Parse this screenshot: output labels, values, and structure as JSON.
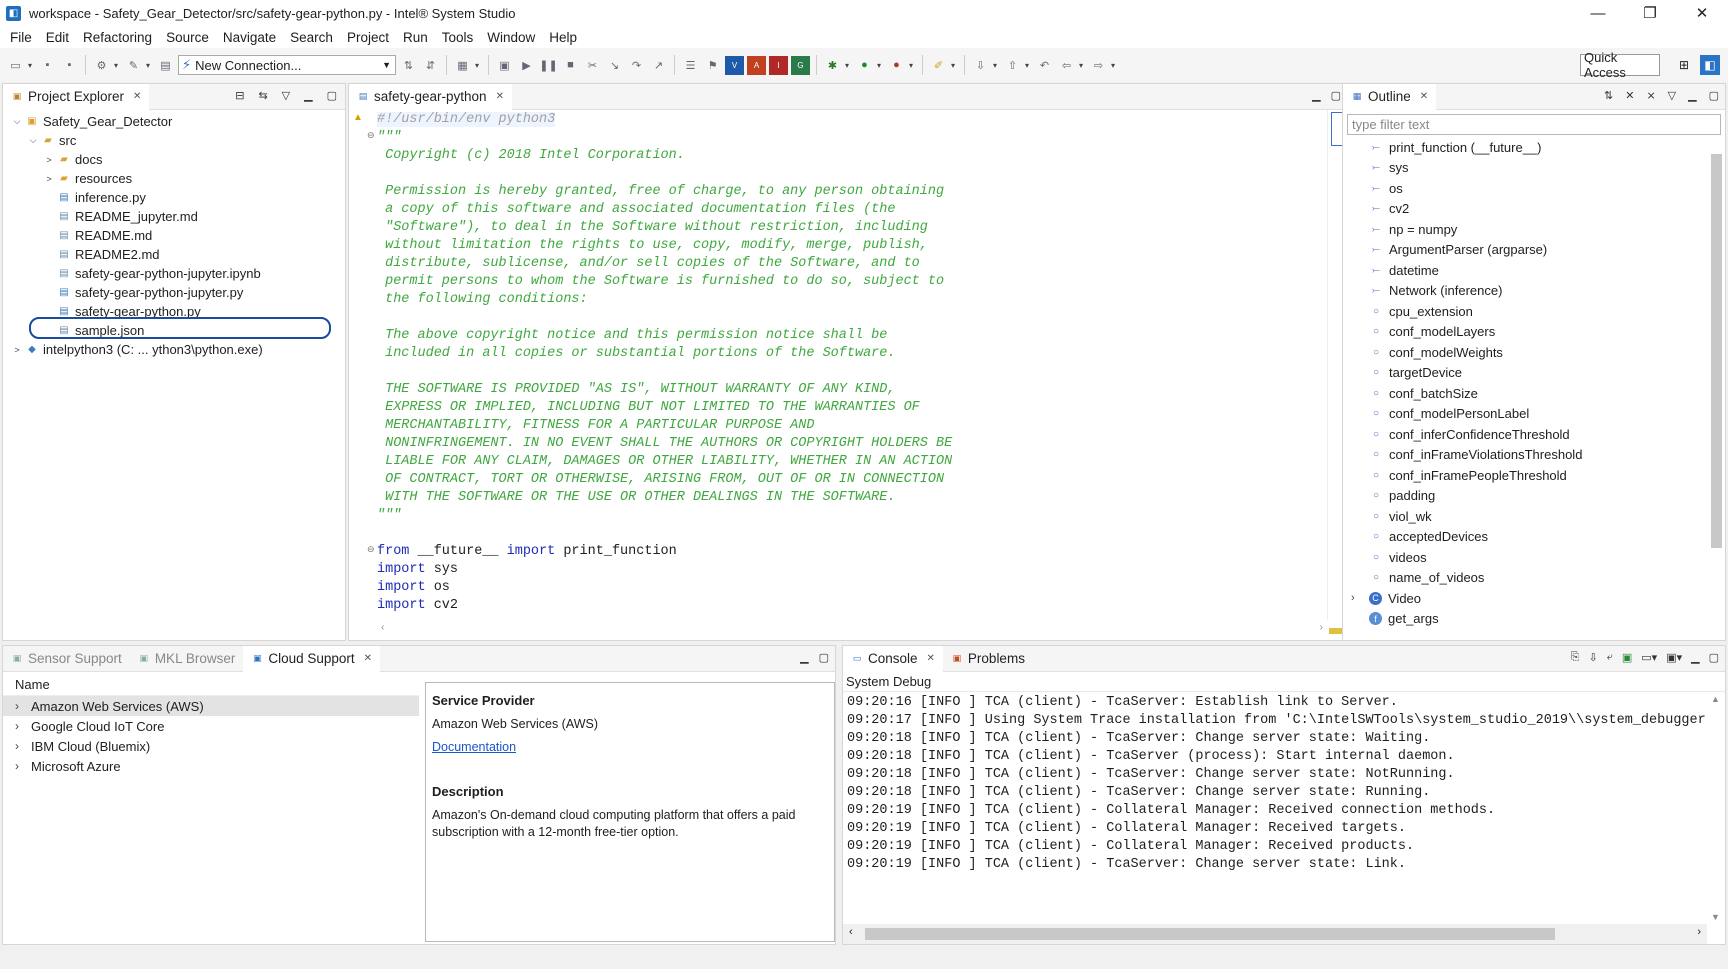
{
  "window": {
    "title": "workspace - Safety_Gear_Detector/src/safety-gear-python.py - Intel® System Studio",
    "minimize": "—",
    "restore": "❐",
    "close": "✕"
  },
  "menu": [
    "File",
    "Edit",
    "Refactoring",
    "Source",
    "Navigate",
    "Search",
    "Project",
    "Run",
    "Tools",
    "Window",
    "Help"
  ],
  "toolbar": {
    "connection": "New Connection...",
    "quick_access": "Quick Access"
  },
  "project_explorer": {
    "tab": "Project Explorer",
    "items": [
      {
        "label": "Safety_Gear_Detector",
        "depth": 0,
        "twisty": "⌵",
        "icon": "project-icon"
      },
      {
        "label": "src",
        "depth": 1,
        "twisty": "⌵",
        "icon": "folder-icon"
      },
      {
        "label": "docs",
        "depth": 2,
        "twisty": ">",
        "icon": "folder-icon"
      },
      {
        "label": "resources",
        "depth": 2,
        "twisty": ">",
        "icon": "folder-icon"
      },
      {
        "label": "inference.py",
        "depth": 2,
        "twisty": "",
        "icon": "python-file-icon"
      },
      {
        "label": "README_jupyter.md",
        "depth": 2,
        "twisty": "",
        "icon": "file-icon"
      },
      {
        "label": "README.md",
        "depth": 2,
        "twisty": "",
        "icon": "file-icon"
      },
      {
        "label": "README2.md",
        "depth": 2,
        "twisty": "",
        "icon": "file-icon"
      },
      {
        "label": "safety-gear-python-jupyter.ipynb",
        "depth": 2,
        "twisty": "",
        "icon": "file-icon"
      },
      {
        "label": "safety-gear-python-jupyter.py",
        "depth": 2,
        "twisty": "",
        "icon": "python-file-icon"
      },
      {
        "label": "safety-gear-python.py",
        "depth": 2,
        "twisty": "",
        "icon": "python-file-icon"
      },
      {
        "label": "sample.json",
        "depth": 2,
        "twisty": "",
        "icon": "file-icon"
      },
      {
        "label": "intelpython3   (C: ... ython3\\python.exe)",
        "depth": 0,
        "twisty": ">",
        "icon": "python-interpreter-icon"
      }
    ]
  },
  "editor": {
    "tab": "safety-gear-python",
    "lines": [
      {
        "t": "#!/usr/bin/env python3",
        "c": "shebang"
      },
      {
        "t": "\"\"\"",
        "c": "cmt"
      },
      {
        "t": " Copyright (c) 2018 Intel Corporation.",
        "c": "cmt"
      },
      {
        "t": "",
        "c": "cmt"
      },
      {
        "t": " Permission is hereby granted, free of charge, to any person obtaining",
        "c": "cmt"
      },
      {
        "t": " a copy of this software and associated documentation files (the",
        "c": "cmt"
      },
      {
        "t": " \"Software\"), to deal in the Software without restriction, including",
        "c": "cmt"
      },
      {
        "t": " without limitation the rights to use, copy, modify, merge, publish,",
        "c": "cmt"
      },
      {
        "t": " distribute, sublicense, and/or sell copies of the Software, and to",
        "c": "cmt"
      },
      {
        "t": " permit persons to whom the Software is furnished to do so, subject to",
        "c": "cmt"
      },
      {
        "t": " the following conditions:",
        "c": "cmt"
      },
      {
        "t": "",
        "c": "cmt"
      },
      {
        "t": " The above copyright notice and this permission notice shall be",
        "c": "cmt"
      },
      {
        "t": " included in all copies or substantial portions of the Software.",
        "c": "cmt"
      },
      {
        "t": "",
        "c": "cmt"
      },
      {
        "t": " THE SOFTWARE IS PROVIDED \"AS IS\", WITHOUT WARRANTY OF ANY KIND,",
        "c": "cmt"
      },
      {
        "t": " EXPRESS OR IMPLIED, INCLUDING BUT NOT LIMITED TO THE WARRANTIES OF",
        "c": "cmt"
      },
      {
        "t": " MERCHANTABILITY, FITNESS FOR A PARTICULAR PURPOSE AND",
        "c": "cmt"
      },
      {
        "t": " NONINFRINGEMENT. IN NO EVENT SHALL THE AUTHORS OR COPYRIGHT HOLDERS BE",
        "c": "cmt"
      },
      {
        "t": " LIABLE FOR ANY CLAIM, DAMAGES OR OTHER LIABILITY, WHETHER IN AN ACTION",
        "c": "cmt"
      },
      {
        "t": " OF CONTRACT, TORT OR OTHERWISE, ARISING FROM, OUT OF OR IN CONNECTION",
        "c": "cmt"
      },
      {
        "t": " WITH THE SOFTWARE OR THE USE OR OTHER DEALINGS IN THE SOFTWARE.",
        "c": "cmt"
      },
      {
        "t": "\"\"\"",
        "c": "cmt"
      },
      {
        "t": "",
        "c": ""
      },
      {
        "t": "from __future__ import print_function",
        "c": "code"
      },
      {
        "t": "import sys",
        "c": "code"
      },
      {
        "t": "import os",
        "c": "code"
      },
      {
        "t": "import cv2",
        "c": "code"
      }
    ]
  },
  "outline": {
    "tab": "Outline",
    "filter_placeholder": "type filter text",
    "items": [
      {
        "label": "print_function (__future__)",
        "kind": "import"
      },
      {
        "label": "sys",
        "kind": "import"
      },
      {
        "label": "os",
        "kind": "import"
      },
      {
        "label": "cv2",
        "kind": "import"
      },
      {
        "label": "np = numpy",
        "kind": "import"
      },
      {
        "label": "ArgumentParser (argparse)",
        "kind": "import"
      },
      {
        "label": "datetime",
        "kind": "import"
      },
      {
        "label": "Network (inference)",
        "kind": "import"
      },
      {
        "label": "cpu_extension",
        "kind": "var"
      },
      {
        "label": "conf_modelLayers",
        "kind": "var"
      },
      {
        "label": "conf_modelWeights",
        "kind": "var"
      },
      {
        "label": "targetDevice",
        "kind": "var"
      },
      {
        "label": "conf_batchSize",
        "kind": "var"
      },
      {
        "label": "conf_modelPersonLabel",
        "kind": "var"
      },
      {
        "label": "conf_inferConfidenceThreshold",
        "kind": "var"
      },
      {
        "label": "conf_inFrameViolationsThreshold",
        "kind": "var"
      },
      {
        "label": "conf_inFramePeopleThreshold",
        "kind": "var"
      },
      {
        "label": "padding",
        "kind": "var"
      },
      {
        "label": "viol_wk",
        "kind": "var"
      },
      {
        "label": "acceptedDevices",
        "kind": "var"
      },
      {
        "label": "videos",
        "kind": "var"
      },
      {
        "label": "name_of_videos",
        "kind": "var"
      },
      {
        "label": "Video",
        "kind": "class"
      },
      {
        "label": "get_args",
        "kind": "function"
      }
    ]
  },
  "bottom_left": {
    "tabs": [
      "Sensor Support",
      "MKL Browser",
      "Cloud Support"
    ],
    "column_header": "Name",
    "providers": [
      "Amazon Web Services (AWS)",
      "Google Cloud IoT Core",
      "IBM Cloud (Bluemix)",
      "Microsoft Azure"
    ],
    "detail": {
      "provider_heading": "Service Provider",
      "provider_value": "Amazon Web Services (AWS)",
      "doc_link": "Documentation",
      "description_heading": "Description",
      "description": "Amazon's On-demand cloud computing platform that offers a paid subscription with a 12-month free-tier option."
    }
  },
  "console": {
    "tabs": [
      "Console",
      "Problems"
    ],
    "name": "System Debug",
    "lines": [
      "09:20:16 [INFO ] TCA (client) - TcaServer: Establish link to Server.",
      "09:20:17 [INFO ] Using System Trace installation from 'C:\\IntelSWTools\\system_studio_2019\\\\system_debugger",
      "09:20:18 [INFO ] TCA (client) - TcaServer: Change server state: Waiting.",
      "09:20:18 [INFO ] TCA (client) - TcaServer (process): Start internal daemon.",
      "09:20:18 [INFO ] TCA (client) - TcaServer: Change server state: NotRunning.",
      "09:20:18 [INFO ] TCA (client) - TcaServer: Change server state: Running.",
      "09:20:19 [INFO ] TCA (client) - Collateral Manager: Received connection methods.",
      "09:20:19 [INFO ] TCA (client) - Collateral Manager: Received targets.",
      "09:20:19 [INFO ] TCA (client) - Collateral Manager: Received products.",
      "09:20:19 [INFO ] TCA (client) - TcaServer: Change server state: Link."
    ]
  }
}
